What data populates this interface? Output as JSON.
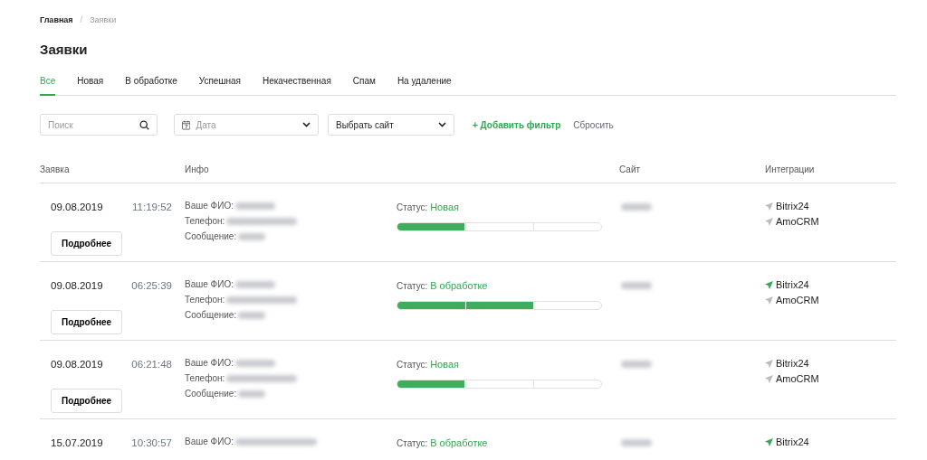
{
  "breadcrumb_separator": "/",
  "breadcrumb": [
    {
      "label": "Главная",
      "current": false
    },
    {
      "label": "Заявки",
      "current": true
    }
  ],
  "title": "Заявки",
  "tabs": [
    {
      "label": "Все",
      "selected": true
    },
    {
      "label": "Новая",
      "selected": false
    },
    {
      "label": "В обработке",
      "selected": false
    },
    {
      "label": "Успешная",
      "selected": false
    },
    {
      "label": "Некачественная",
      "selected": false
    },
    {
      "label": "Спам",
      "selected": false
    },
    {
      "label": "На удаление",
      "selected": false
    }
  ],
  "filters": {
    "search": {
      "placeholder": "Поиск"
    },
    "date": {
      "placeholder": "Дата"
    },
    "site": {
      "value": "Выбрать сайт"
    },
    "add_filter": "+ Добавить фильтр",
    "reset": "Сбросить"
  },
  "table": {
    "columns": [
      "Заявка",
      "Инфо",
      "Сайт",
      "Интеграции"
    ],
    "rows": [
      {
        "date": "09.08.2019",
        "time": "11:19:52",
        "button": "Подробнее",
        "fields": [
          {
            "label": "Ваше ФИО:",
            "redacted": true
          },
          {
            "label": "Телефон:",
            "redacted": true
          },
          {
            "label": "Сообщение:",
            "redacted": true
          }
        ],
        "status_label": "Статус:",
        "status": "Новая",
        "level": 0.33,
        "site_redacted": true,
        "integrations": [
          {
            "name": "Bitrix24",
            "active": false
          },
          {
            "name": "AmoCRM",
            "active": false
          }
        ]
      },
      {
        "date": "09.08.2019",
        "time": "06:25:39",
        "button": "Подробнее",
        "fields": [
          {
            "label": "Ваше ФИО:",
            "redacted": true
          },
          {
            "label": "Телефон:",
            "redacted": true
          },
          {
            "label": "Сообщение:",
            "redacted": true
          }
        ],
        "status_label": "Статус:",
        "status": "В обработке",
        "level": 0.67,
        "site_redacted": true,
        "integrations": [
          {
            "name": "Bitrix24",
            "active": true
          },
          {
            "name": "AmoCRM",
            "active": false
          }
        ]
      },
      {
        "date": "09.08.2019",
        "time": "06:21:48",
        "button": "Подробнее",
        "fields": [
          {
            "label": "Ваше ФИО:",
            "redacted": true
          },
          {
            "label": "Телефон:",
            "redacted": true
          },
          {
            "label": "Сообщение:",
            "redacted": true
          }
        ],
        "status_label": "Статус:",
        "status": "Новая",
        "level": 0.33,
        "site_redacted": true,
        "integrations": [
          {
            "name": "Bitrix24",
            "active": false
          },
          {
            "name": "AmoCRM",
            "active": false
          }
        ]
      },
      {
        "date": "15.07.2019",
        "time": "10:30:57",
        "fields": [
          {
            "label": "Ваше ФИО:",
            "redacted": true
          }
        ],
        "status_label": "Статус:",
        "status": "В обработке",
        "site_redacted": true,
        "integrations": [
          {
            "name": "Bitrix24",
            "active": true
          }
        ]
      }
    ]
  }
}
